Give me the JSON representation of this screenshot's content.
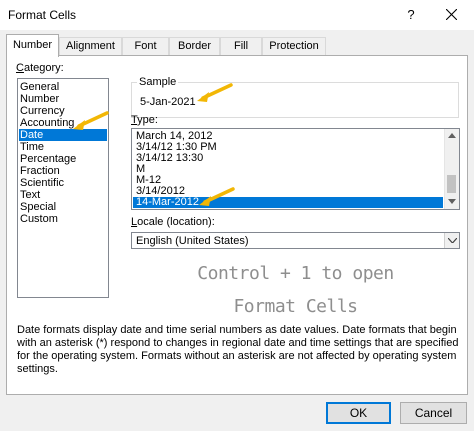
{
  "window": {
    "title": "Format Cells",
    "help_glyph": "?"
  },
  "tabs": [
    {
      "label": "Number",
      "active": true
    },
    {
      "label": "Alignment"
    },
    {
      "label": "Font"
    },
    {
      "label": "Border"
    },
    {
      "label": "Fill"
    },
    {
      "label": "Protection"
    }
  ],
  "category": {
    "label_a": "C",
    "label_b": "ategory:",
    "items": [
      "General",
      "Number",
      "Currency",
      "Accounting",
      "Date",
      "Time",
      "Percentage",
      "Fraction",
      "Scientific",
      "Text",
      "Special",
      "Custom"
    ],
    "selected": "Date"
  },
  "sample": {
    "label": "Sample",
    "value": "5-Jan-2021"
  },
  "type": {
    "label_a": "T",
    "label_b": "ype:",
    "items": [
      "March 14, 2012",
      "3/14/12 1:30 PM",
      "3/14/12 13:30",
      "M",
      "M-12",
      "3/14/2012",
      "14-Mar-2012"
    ],
    "selected": "14-Mar-2012"
  },
  "locale": {
    "label_a": "L",
    "label_b": "ocale (location):",
    "value": "English (United States)"
  },
  "overlay": {
    "line1": "Control + 1 to open",
    "line2": "Format Cells"
  },
  "description": "Date formats display date and time serial numbers as date values.  Date formats that begin with an asterisk (*) respond to changes in regional date and time settings that are specified for the operating system. Formats without an asterisk are not affected by operating system settings.",
  "buttons": {
    "ok": "OK",
    "cancel": "Cancel"
  },
  "colors": {
    "selection": "#0078d7",
    "annotation_arrow": "#f2b705"
  },
  "icons": {
    "close": "close-icon",
    "scroll_up": "scroll-up-arrow-icon",
    "scroll_down": "scroll-down-arrow-icon",
    "dropdown": "chevron-down-icon"
  }
}
